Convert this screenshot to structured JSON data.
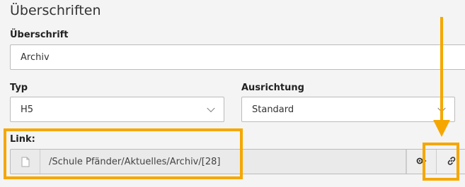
{
  "section": {
    "title": "Überschriften"
  },
  "headline": {
    "label": "Überschrift",
    "value": "Archiv"
  },
  "type": {
    "label": "Typ",
    "value": "H5"
  },
  "alignment": {
    "label": "Ausrichtung",
    "value": "Standard"
  },
  "link": {
    "label": "Link:",
    "value": "/Schule Pfänder/Aktuelles/Archiv/[28]",
    "page_icon": "page-icon",
    "target_icon": "link-target-icon",
    "browse_icon": "link-icon"
  },
  "colors": {
    "annotation": "#f5a700"
  }
}
